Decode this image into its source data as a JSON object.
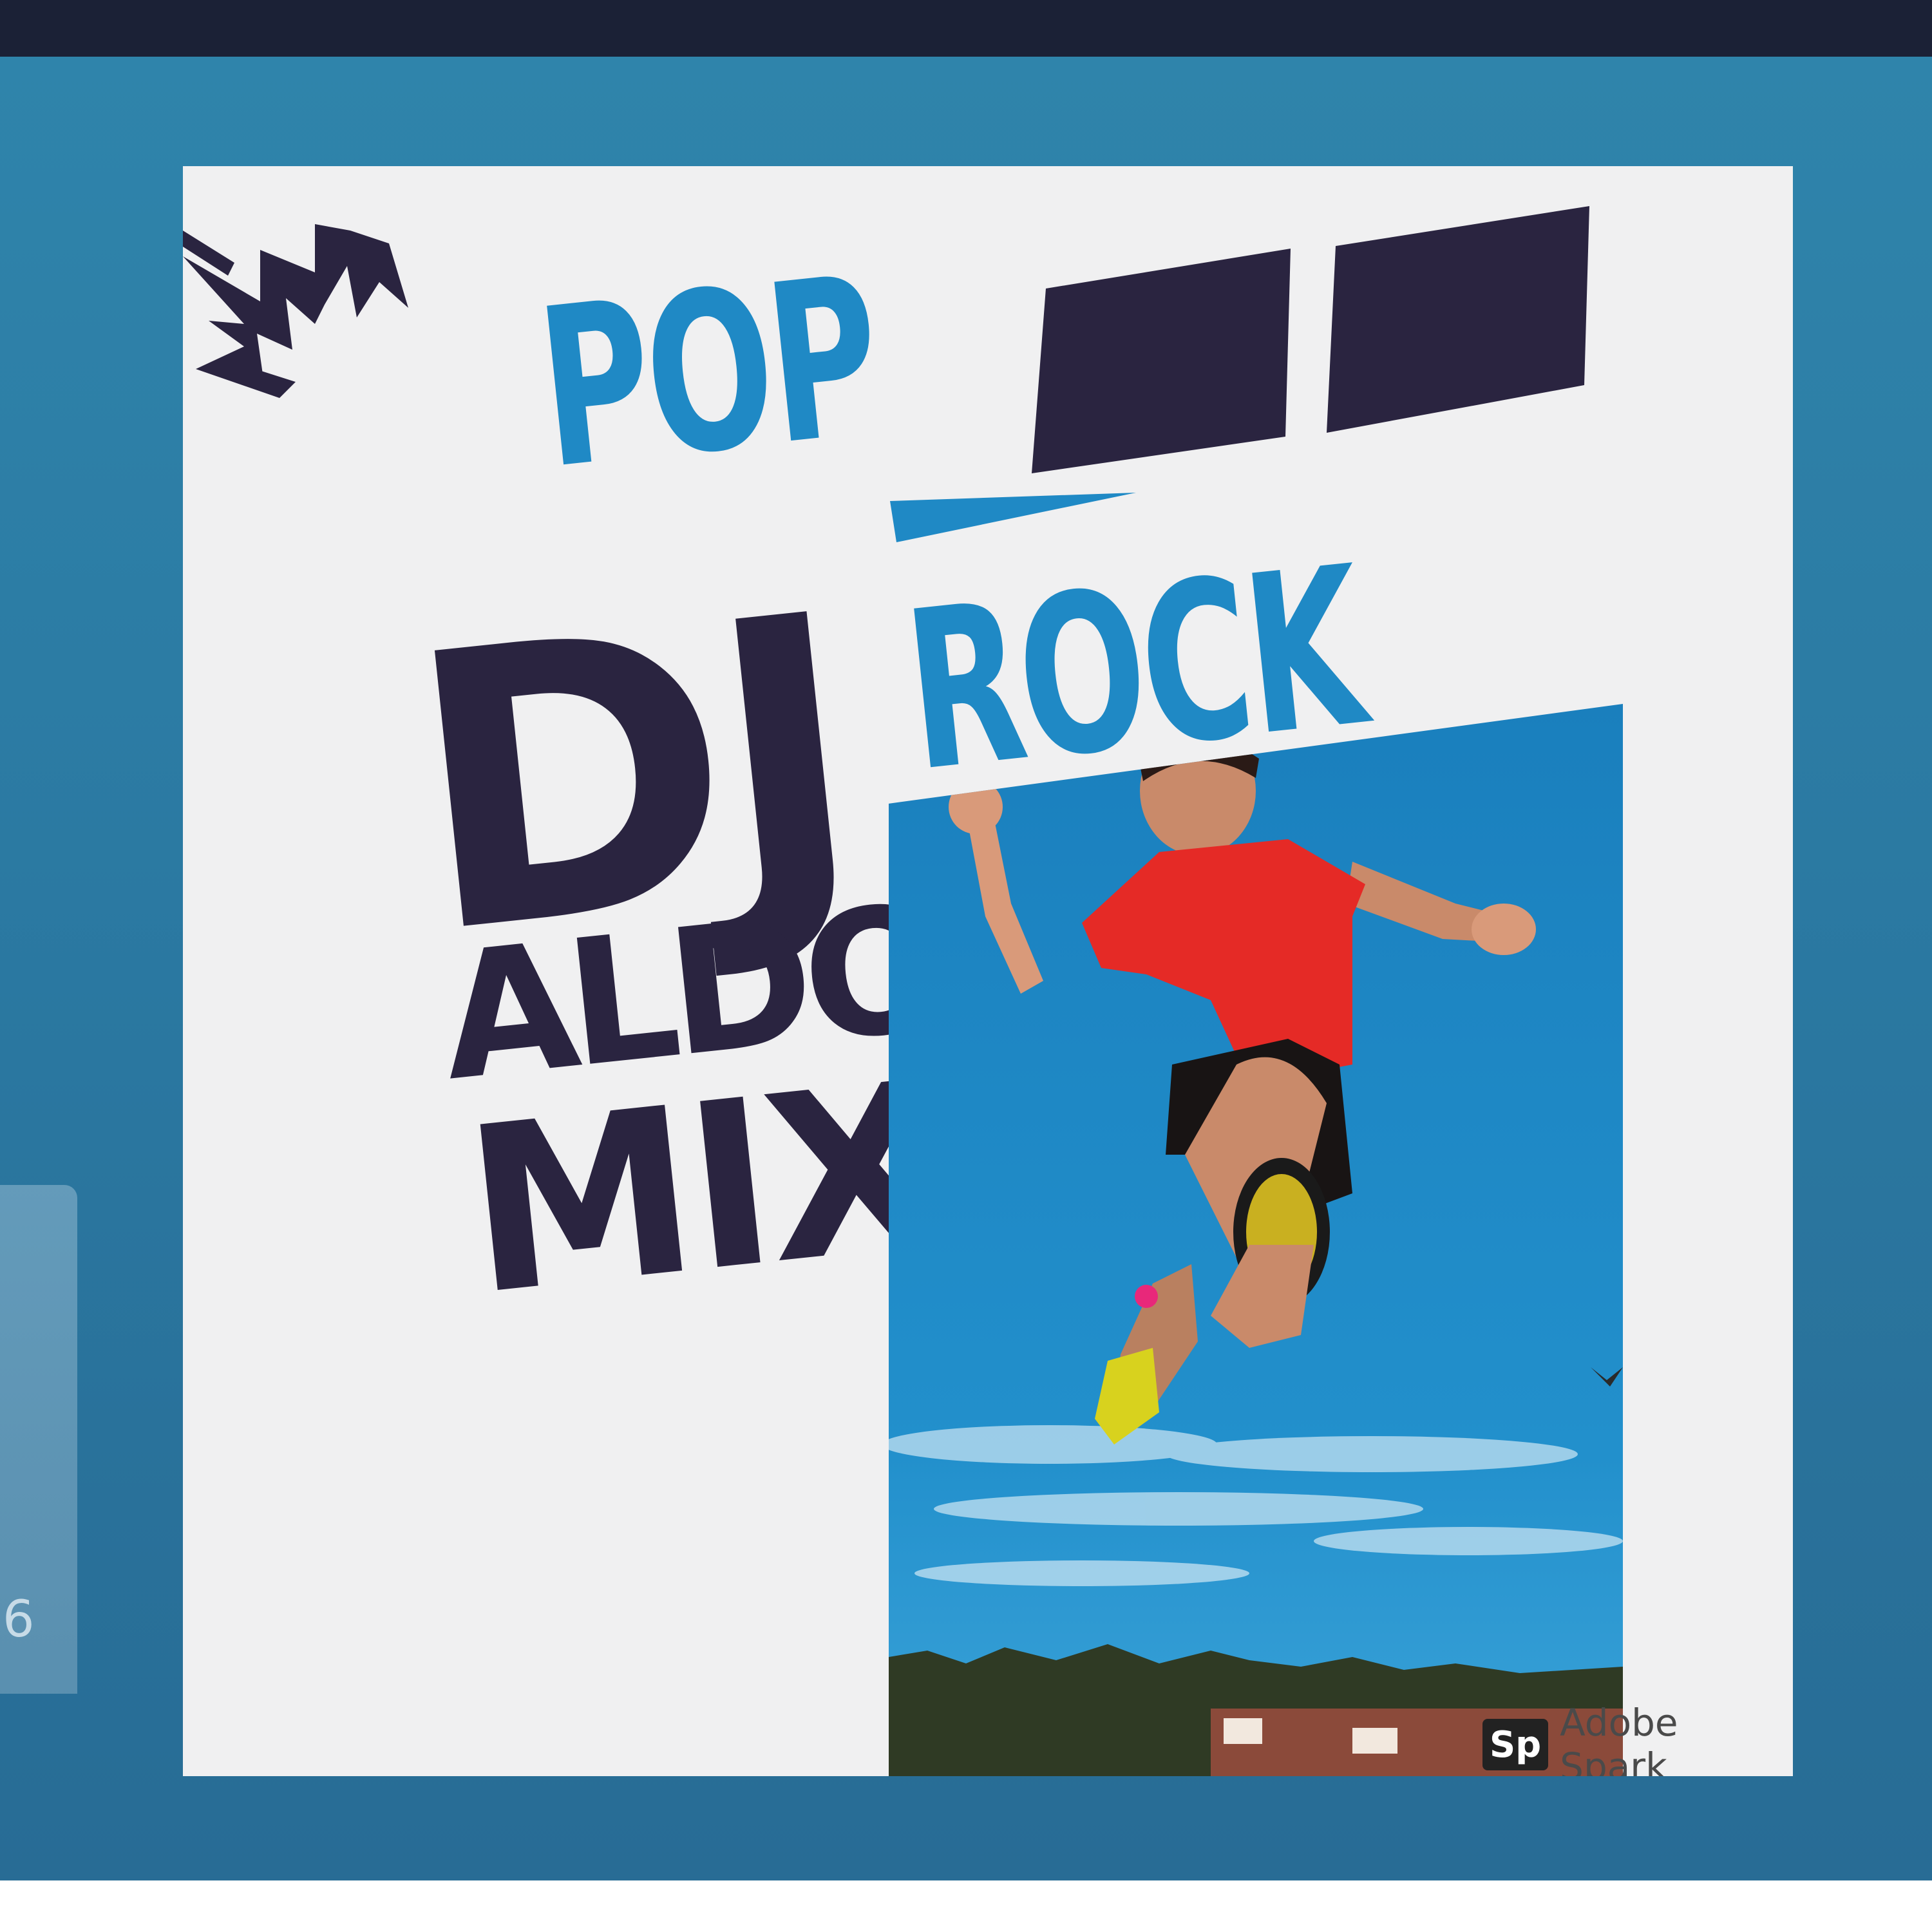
{
  "poster": {
    "pop": "POP",
    "rock": "ROCK",
    "dj": "DJ",
    "aldo": "ALDO",
    "mix": "MIX"
  },
  "watermark": {
    "logo": "Sp",
    "text": "Adobe Spark"
  },
  "side_card": {
    "text": "6"
  },
  "colors": {
    "top_bar": "#1b2136",
    "frame": "#2f84ab",
    "poster_bg": "#f0f0f1",
    "accent_blue": "#1f89c5",
    "dark_navy": "#2a2440",
    "shirt_red": "#e52a26",
    "sky": "#1f86c1"
  }
}
